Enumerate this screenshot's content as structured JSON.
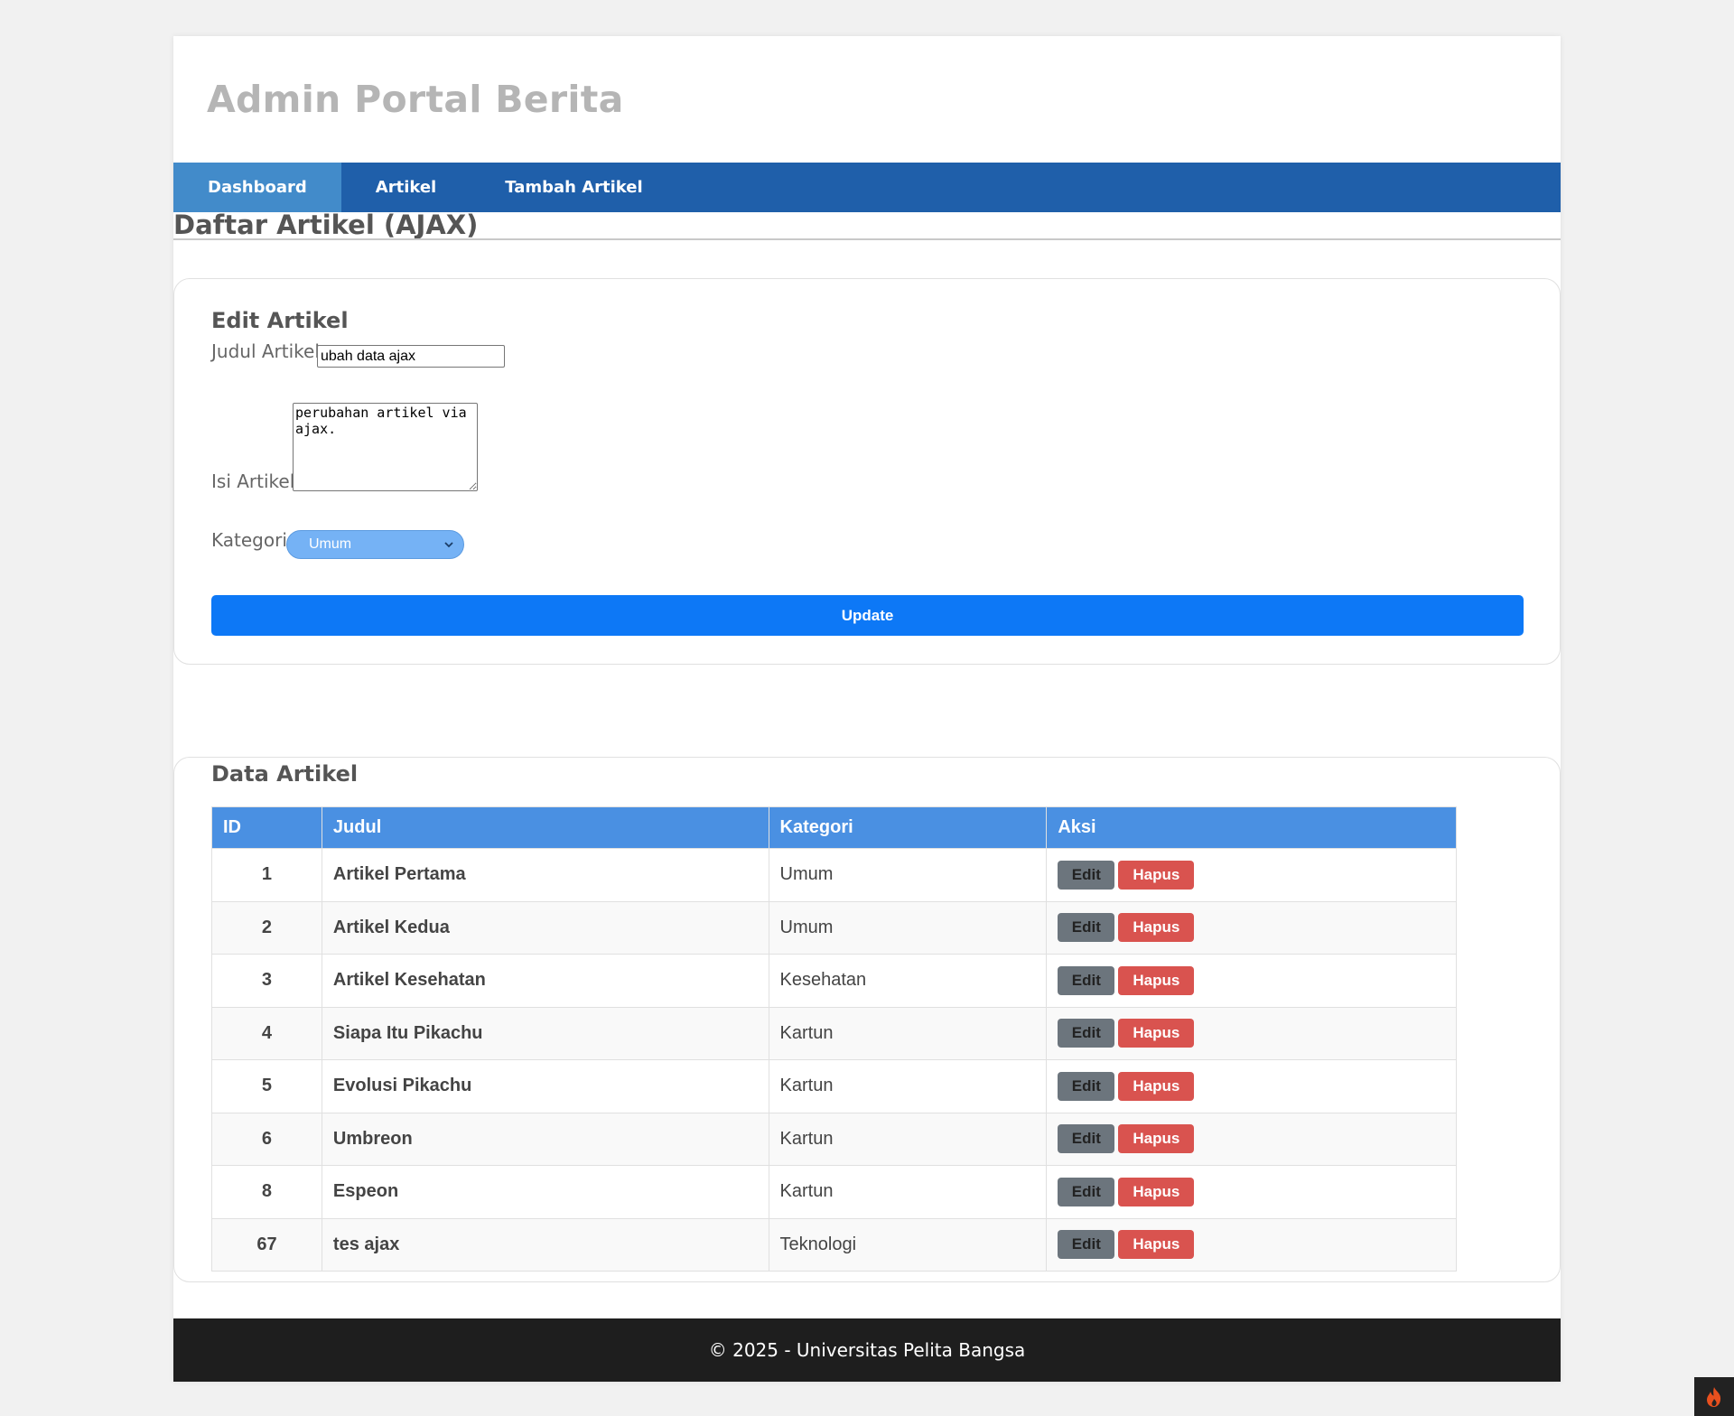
{
  "header": {
    "title": "Admin Portal Berita"
  },
  "nav": {
    "items": [
      {
        "label": "Dashboard"
      },
      {
        "label": "Artikel"
      },
      {
        "label": "Tambah Artikel"
      }
    ]
  },
  "page": {
    "title": "Daftar Artikel (AJAX)"
  },
  "edit_form": {
    "heading": "Edit Artikel",
    "judul_label": "Judul Artikel",
    "judul_value": "ubah data ajax",
    "isi_label": "Isi Artikel",
    "isi_value": "perubahan artikel via ajax.",
    "kategori_label": "Kategori",
    "kategori_value": "Umum",
    "update_label": "Update"
  },
  "data_section": {
    "heading": "Data Artikel",
    "columns": [
      "ID",
      "Judul",
      "Kategori",
      "Aksi"
    ],
    "edit_label": "Edit",
    "hapus_label": "Hapus",
    "rows": [
      {
        "id": "1",
        "judul": "Artikel Pertama",
        "kategori": "Umum"
      },
      {
        "id": "2",
        "judul": "Artikel Kedua",
        "kategori": "Umum"
      },
      {
        "id": "3",
        "judul": "Artikel Kesehatan",
        "kategori": "Kesehatan"
      },
      {
        "id": "4",
        "judul": "Siapa Itu Pikachu",
        "kategori": "Kartun"
      },
      {
        "id": "5",
        "judul": "Evolusi Pikachu",
        "kategori": "Kartun"
      },
      {
        "id": "6",
        "judul": "Umbreon",
        "kategori": "Kartun"
      },
      {
        "id": "8",
        "judul": "Espeon",
        "kategori": "Kartun"
      },
      {
        "id": "67",
        "judul": "tes ajax",
        "kategori": "Teknologi"
      }
    ]
  },
  "footer": {
    "text": "© 2025 - Universitas Pelita Bangsa"
  },
  "icons": {
    "toolbar": "flame-icon",
    "select": "chevron-down-icon"
  },
  "colors": {
    "nav": "#1f5faa",
    "nav_active": "#428bca",
    "table_header": "#4a90e2",
    "update": "#0d78f6",
    "hapus": "#d9534f",
    "edit": "#6c757d",
    "footer": "#1e1e1e"
  }
}
